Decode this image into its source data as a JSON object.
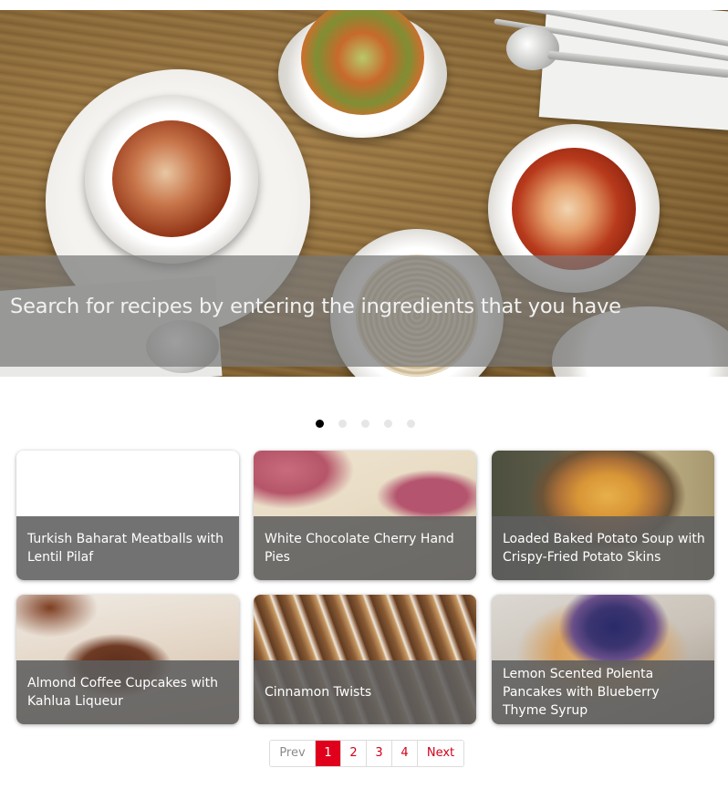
{
  "hero": {
    "caption": "Search for recipes by entering the ingredients that you have"
  },
  "carousel": {
    "dot_count": 5,
    "active_index": 0
  },
  "recipes": [
    {
      "title": "Turkish Baharat Meatballs with Lentil Pilaf"
    },
    {
      "title": "White Chocolate Cherry Hand Pies"
    },
    {
      "title": "Loaded Baked Potato Soup with Crispy-Fried Potato Skins"
    },
    {
      "title": "Almond Coffee Cupcakes with Kahlua Liqueur"
    },
    {
      "title": "Cinnamon Twists"
    },
    {
      "title": "Lemon Scented Polenta Pancakes with Blueberry Thyme Syrup"
    }
  ],
  "pagination": {
    "prev_label": "Prev",
    "pages": [
      "1",
      "2",
      "3",
      "4"
    ],
    "current": "1",
    "next_label": "Next"
  },
  "colors": {
    "accent": "#e0001b",
    "caption_band": "#787878",
    "card_overlay": "#5f5f5f"
  }
}
